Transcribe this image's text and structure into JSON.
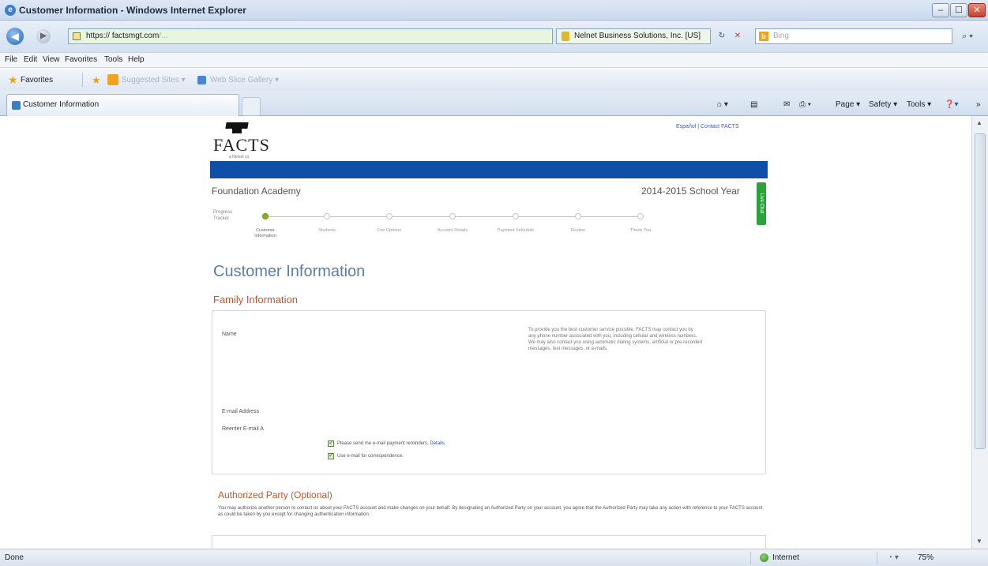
{
  "window": {
    "title": "Customer Information - Windows Internet Explorer",
    "min_glyph": "–",
    "max_glyph": "☐",
    "close_glyph": "✕"
  },
  "addressbar": {
    "back_glyph": "◀",
    "forward_glyph": "▶",
    "url_prefix": "https",
    "url_host": "factsmgt.com",
    "url_rest": "/...",
    "cert_text": "Nelnet Business Solutions, Inc. [US]",
    "refresh_glyph": "↻",
    "stop_glyph": "✕",
    "search_placeholder": "Bing",
    "search_icon": "search-icon",
    "search_glyph": "⌕ ▾"
  },
  "menu": [
    "File",
    "Edit",
    "View",
    "Favorites",
    "Tools",
    "Help"
  ],
  "favorites": {
    "label": "Favorites",
    "suggested": "Suggested Sites ▾",
    "webslice": "Web Slice Gallery ▾"
  },
  "tabs": [
    {
      "label": "Customer Information"
    }
  ],
  "commandbar": {
    "home_glyph": "⌂ ▾",
    "feeds_glyph": "▤",
    "mail_glyph": "✉",
    "print_glyph": "⎙ ▾",
    "page": "Page ▾",
    "safety": "Safety ▾",
    "tools": "Tools ▾",
    "help": "❓▾",
    "more": "»"
  },
  "page": {
    "logo_text": "FACTS",
    "logo_sub": "a Nelnet co.",
    "toplinks": "Español  |  Contact FACTS",
    "school": "Foundation Academy",
    "year": "2014-2015 School Year",
    "side_tab": "Live Chat",
    "progress_label": "Progress Tracker",
    "steps": [
      {
        "label": "Customer Information",
        "active": true
      },
      {
        "label": "Students",
        "active": false
      },
      {
        "label": "Fee Options",
        "active": false
      },
      {
        "label": "Account Details",
        "active": false
      },
      {
        "label": "Payment Schedule",
        "active": false
      },
      {
        "label": "Review",
        "active": false
      },
      {
        "label": "Thank You",
        "active": false
      }
    ],
    "heading": "Customer Information",
    "family_heading": "Family Information",
    "name_label": "Name",
    "notice": "To provide you the best customer service possible, FACTS may contact you by any phone number associated with you, including cellular and wireless numbers. We may also contact you using automatic dialing systems, artificial or pre-recorded messages, text messages, or e-mails.",
    "email_label": "E-mail Address",
    "reenter_label": "Reenter E-mail A",
    "reminder_text": "Please send me e-mail payment reminders.",
    "details_link": "Details",
    "correspondence_text": "Use e-mail for correspondence.",
    "auth_heading": "Authorized Party (Optional)",
    "auth_text": "You may authorize another person to contact us about your FACTS account and make changes on your behalf. By designating an Authorized Party on your account, you agree that the Authorized Party may take any action with reference to your FACTS account as could be taken by you except for changing authentication information."
  },
  "status": {
    "left": "Done",
    "zone": "Internet",
    "zoom_icon": "◔ ▾",
    "zoom": "75%"
  }
}
